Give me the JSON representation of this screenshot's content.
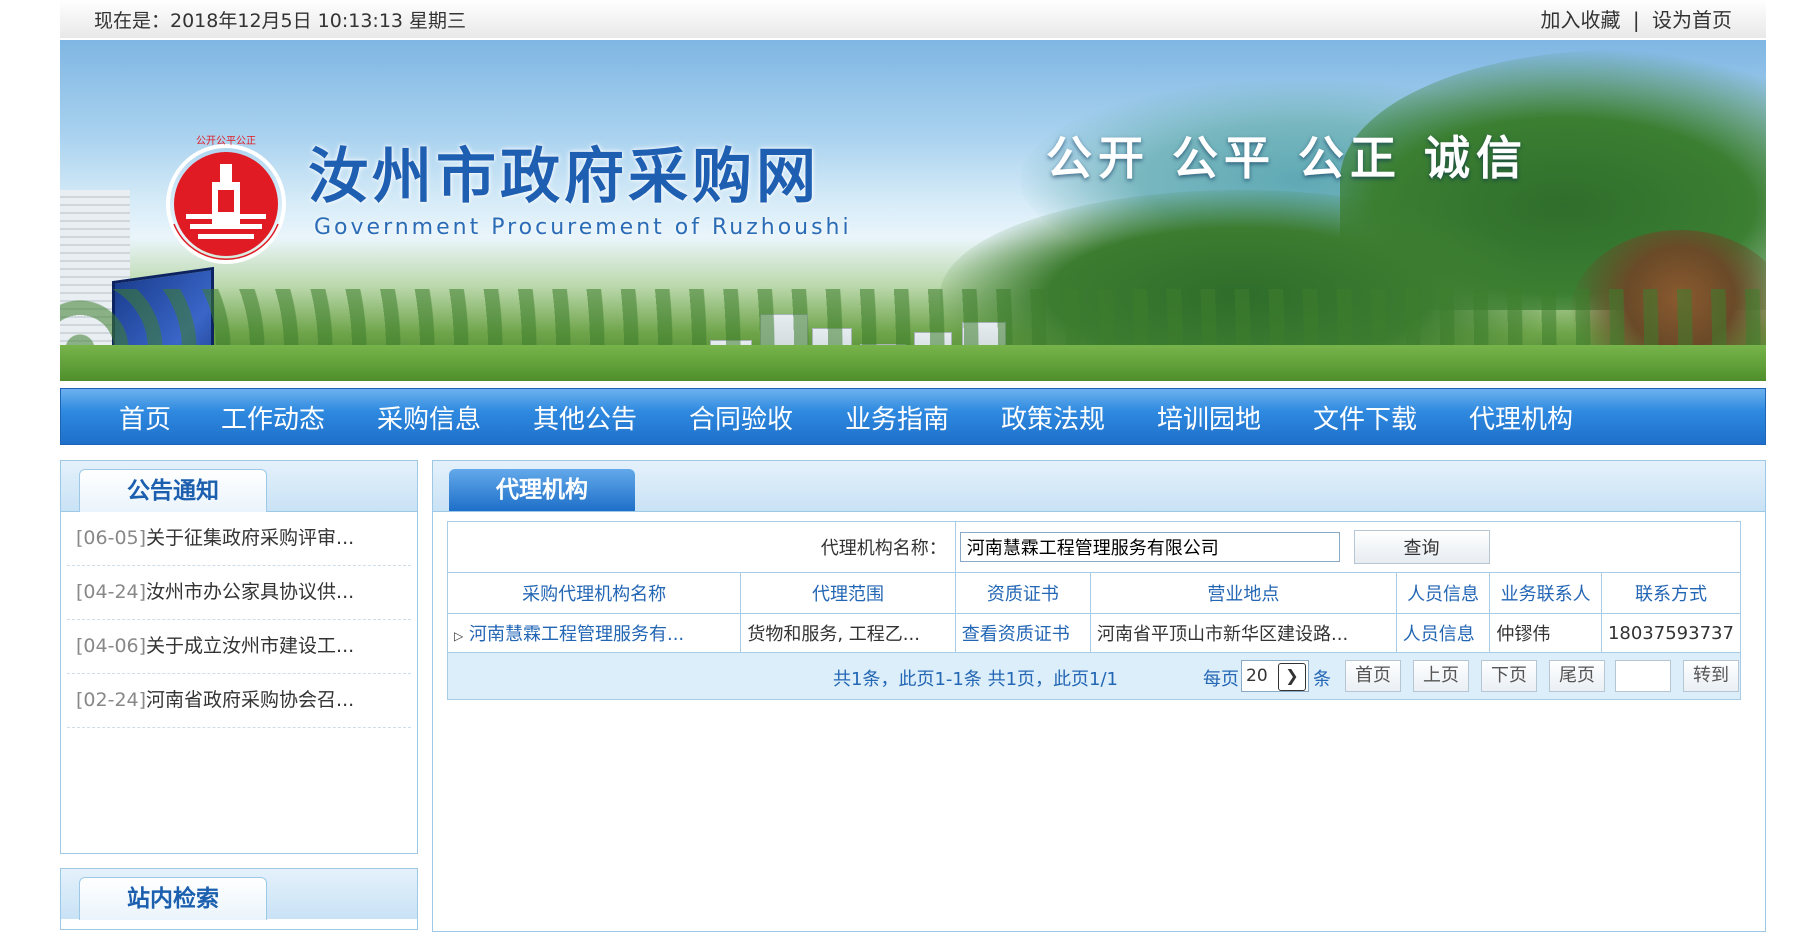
{
  "topbar": {
    "datetime": "现在是：2018年12月5日 10:13:13 星期三",
    "add_favorite": "加入收藏",
    "separator": "|",
    "set_homepage": "设为首页"
  },
  "banner": {
    "title": "汝州市政府采购网",
    "subtitle": "Government Procurement of Ruzhoushi",
    "slogan": "公开 公平 公正 诚信",
    "seal_text": "公开公平公正"
  },
  "nav": [
    "首页",
    "工作动态",
    "采购信息",
    "其他公告",
    "合同验收",
    "业务指南",
    "政策法规",
    "培训园地",
    "文件下载",
    "代理机构"
  ],
  "notice": {
    "title": "公告通知",
    "items": [
      {
        "date": "[06-05]",
        "text": "关于征集政府采购评审..."
      },
      {
        "date": "[04-24]",
        "text": "汝州市办公家具协议供..."
      },
      {
        "date": "[04-06]",
        "text": "关于成立汝州市建设工..."
      },
      {
        "date": "[02-24]",
        "text": "河南省政府采购协会召..."
      }
    ]
  },
  "search_panel": {
    "title": "站内检索"
  },
  "main": {
    "tab": "代理机构",
    "search_label": "代理机构名称：",
    "search_value": "河南慧霖工程管理服务有限公司",
    "search_button": "查询",
    "columns": [
      "采购代理机构名称",
      "代理范围",
      "资质证书",
      "营业地点",
      "人员信息",
      "业务联系人",
      "联系方式"
    ],
    "rows": [
      {
        "name": "河南慧霖工程管理服务有...",
        "scope": "货物和服务, 工程乙...",
        "cert": "查看资质证书",
        "address": "河南省平顶山市新华区建设路...",
        "staff": "人员信息",
        "contact": "仲镠伟",
        "phone": "18037593737"
      }
    ],
    "pager": {
      "summary": "共1条，此页1-1条 共1页，此页1/1",
      "per_page_label": "每页",
      "per_page_value": "20",
      "per_page_unit": "条",
      "first": "首页",
      "prev": "上页",
      "next": "下页",
      "last": "尾页",
      "goto": "转到"
    }
  },
  "colors": {
    "accent": "#1e6fc9",
    "link": "#2366b4",
    "border": "#9dc9e6"
  }
}
